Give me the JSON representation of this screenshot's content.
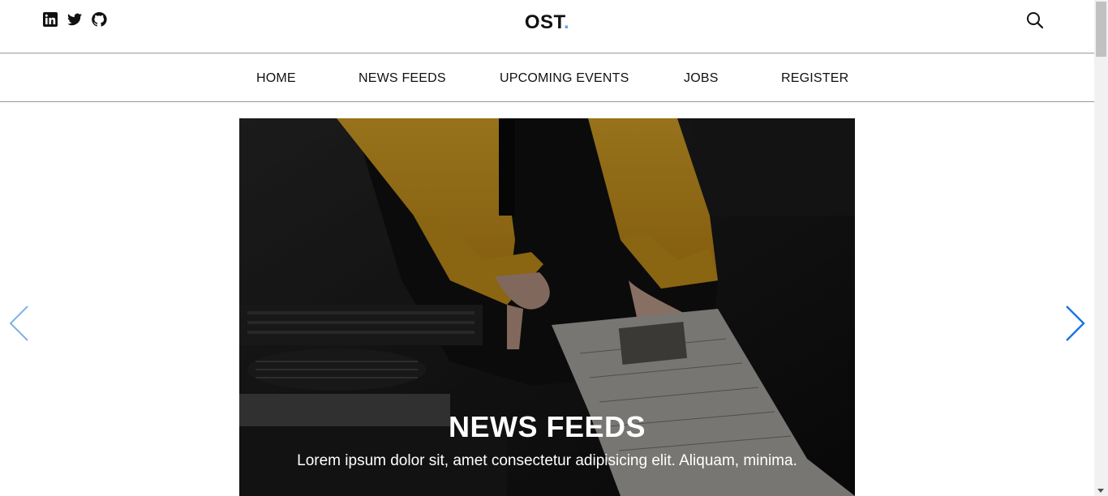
{
  "header": {
    "logo_text": "OST",
    "logo_dot": ".",
    "social_icons": [
      "linkedin-icon",
      "twitter-icon",
      "github-icon"
    ],
    "search_icon": "search-icon"
  },
  "nav": {
    "items": [
      {
        "label": "HOME"
      },
      {
        "label": "NEWS FEEDS"
      },
      {
        "label": "UPCOMING EVENTS"
      },
      {
        "label": "JOBS"
      },
      {
        "label": "REGISTER"
      }
    ]
  },
  "carousel": {
    "slide": {
      "title": "NEWS FEEDS",
      "text": "Lorem ipsum dolor sit, amet consectetur adipisicing elit. Aliquam, minima."
    },
    "prev_icon": "chevron-left-icon",
    "next_icon": "chevron-right-icon"
  },
  "colors": {
    "accent": "#1a73e8",
    "logo_dot": "#6aa2e0",
    "jacket": "#e2a823"
  }
}
